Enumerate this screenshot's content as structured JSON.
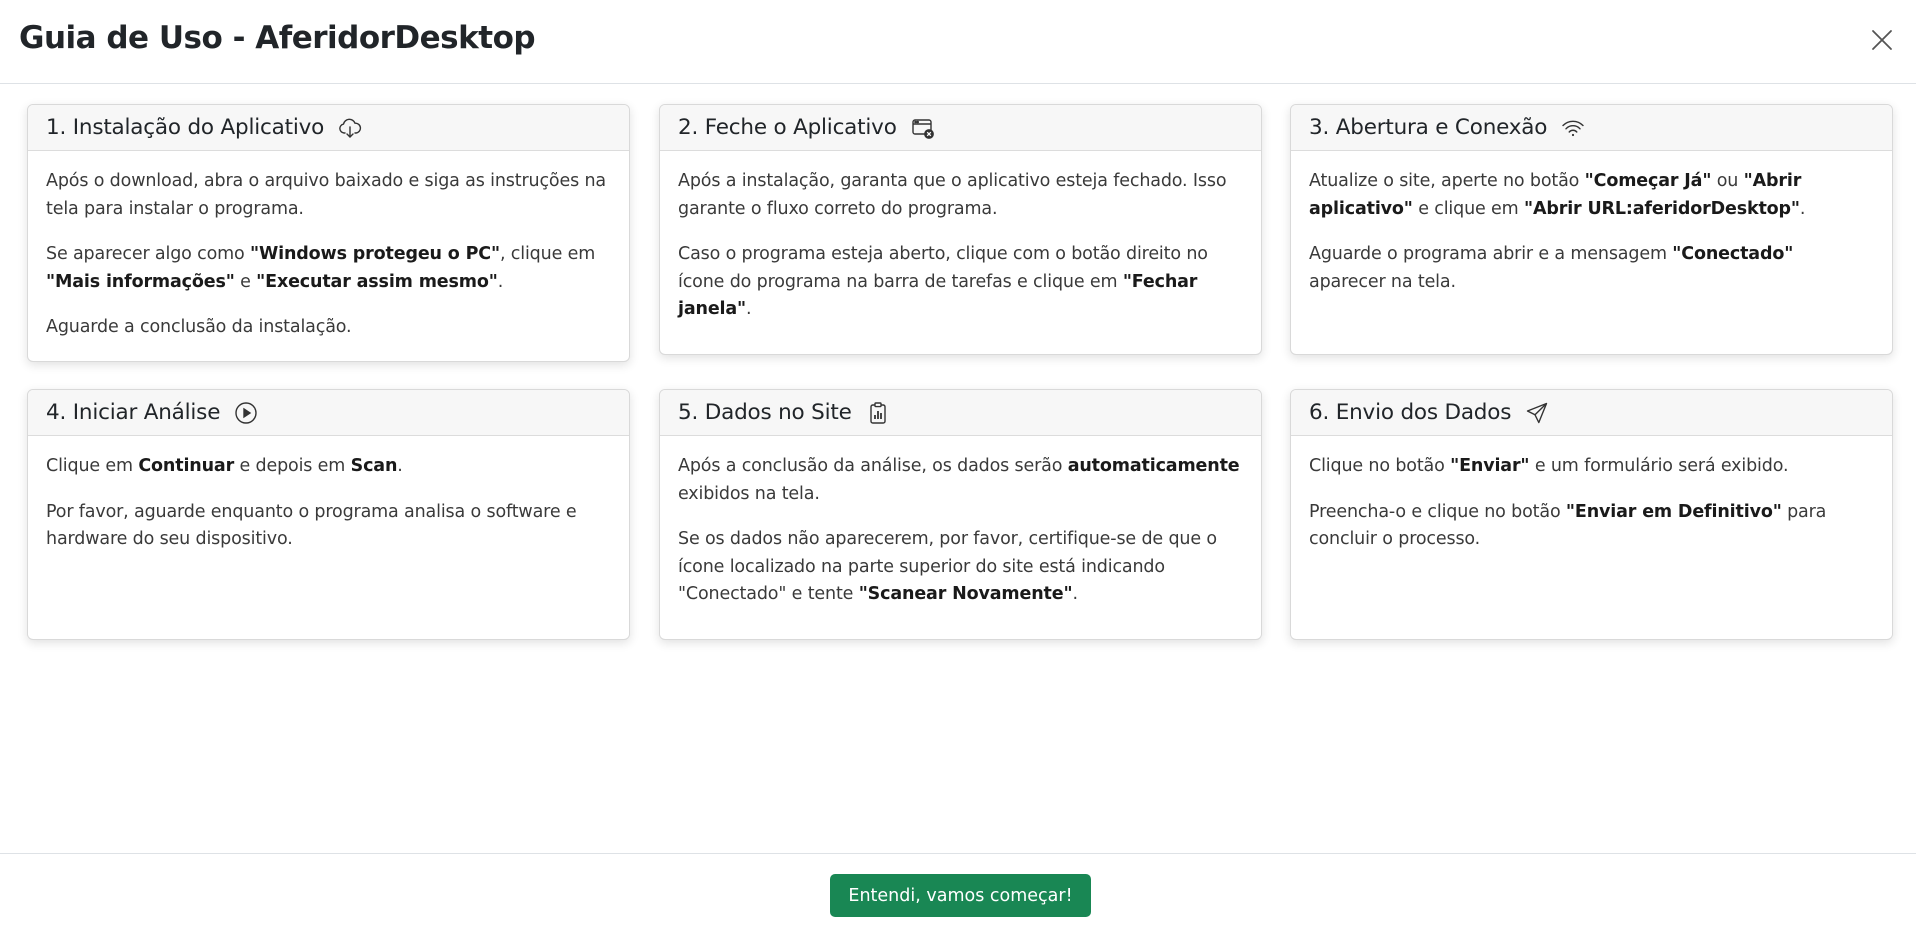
{
  "modal": {
    "title": "Guia de Uso - AferidorDesktop",
    "close_icon": "close-x-icon",
    "footer_button": "Entendi, vamos começar!"
  },
  "colors": {
    "primary_button": "#198754",
    "card_header_bg": "#f7f7f7"
  },
  "cards": [
    {
      "title": "1. Instalação do Aplicativo",
      "icon": "cloud-download-icon",
      "paragraphs": [
        [
          {
            "t": "Após o download, abra o arquivo baixado e siga as instruções na tela para instalar o programa."
          }
        ],
        [
          {
            "t": "Se aparecer algo como "
          },
          {
            "t": "\"Windows protegeu o PC\"",
            "b": true
          },
          {
            "t": ", clique em "
          },
          {
            "t": "\"Mais informações\"",
            "b": true
          },
          {
            "t": " e "
          },
          {
            "t": "\"Executar assim mesmo\"",
            "b": true
          },
          {
            "t": "."
          }
        ],
        [
          {
            "t": "Aguarde a conclusão da instalação."
          }
        ]
      ]
    },
    {
      "title": "2. Feche o Aplicativo",
      "icon": "window-close-icon",
      "paragraphs": [
        [
          {
            "t": "Após a instalação, garanta que o aplicativo esteja fechado. Isso garante o fluxo correto do programa."
          }
        ],
        [
          {
            "t": "Caso o programa esteja aberto, clique com o botão direito no ícone do programa na barra de tarefas e clique em "
          },
          {
            "t": "\"Fechar janela\"",
            "b": true
          },
          {
            "t": "."
          }
        ]
      ]
    },
    {
      "title": "3. Abertura e Conexão",
      "icon": "wifi-icon",
      "paragraphs": [
        [
          {
            "t": "Atualize o site, aperte no botão "
          },
          {
            "t": "\"Começar Já\"",
            "b": true
          },
          {
            "t": " ou "
          },
          {
            "t": "\"Abrir aplicativo\"",
            "b": true
          },
          {
            "t": " e clique em "
          },
          {
            "t": "\"Abrir URL:aferidorDesktop\"",
            "b": true
          },
          {
            "t": "."
          }
        ],
        [
          {
            "t": "Aguarde o programa abrir e a mensagem "
          },
          {
            "t": "\"Conectado\"",
            "b": true
          },
          {
            "t": " aparecer na tela."
          }
        ]
      ]
    },
    {
      "title": "4. Iniciar Análise",
      "icon": "play-circle-icon",
      "paragraphs": [
        [
          {
            "t": "Clique em "
          },
          {
            "t": "Continuar",
            "b": true
          },
          {
            "t": " e depois em "
          },
          {
            "t": "Scan",
            "b": true
          },
          {
            "t": "."
          }
        ],
        [
          {
            "t": "Por favor, aguarde enquanto o programa analisa o software e hardware do seu dispositivo."
          }
        ]
      ]
    },
    {
      "title": "5. Dados no Site",
      "icon": "clipboard-data-icon",
      "paragraphs": [
        [
          {
            "t": "Após a conclusão da análise, os dados serão "
          },
          {
            "t": "automaticamente",
            "b": true
          },
          {
            "t": " exibidos na tela."
          }
        ],
        [
          {
            "t": "Se os dados não aparecerem, por favor, certifique-se de que o ícone localizado na parte superior do site está indicando \"Conectado\" e tente "
          },
          {
            "t": "\"Scanear Novamente\"",
            "b": true
          },
          {
            "t": "."
          }
        ]
      ]
    },
    {
      "title": "6. Envio dos Dados",
      "icon": "send-icon",
      "paragraphs": [
        [
          {
            "t": "Clique no botão "
          },
          {
            "t": "\"Enviar\"",
            "b": true
          },
          {
            "t": " e um formulário será exibido."
          }
        ],
        [
          {
            "t": "Preencha-o e clique no botão "
          },
          {
            "t": "\"Enviar em Definitivo\"",
            "b": true
          },
          {
            "t": " para concluir o processo."
          }
        ]
      ]
    }
  ]
}
